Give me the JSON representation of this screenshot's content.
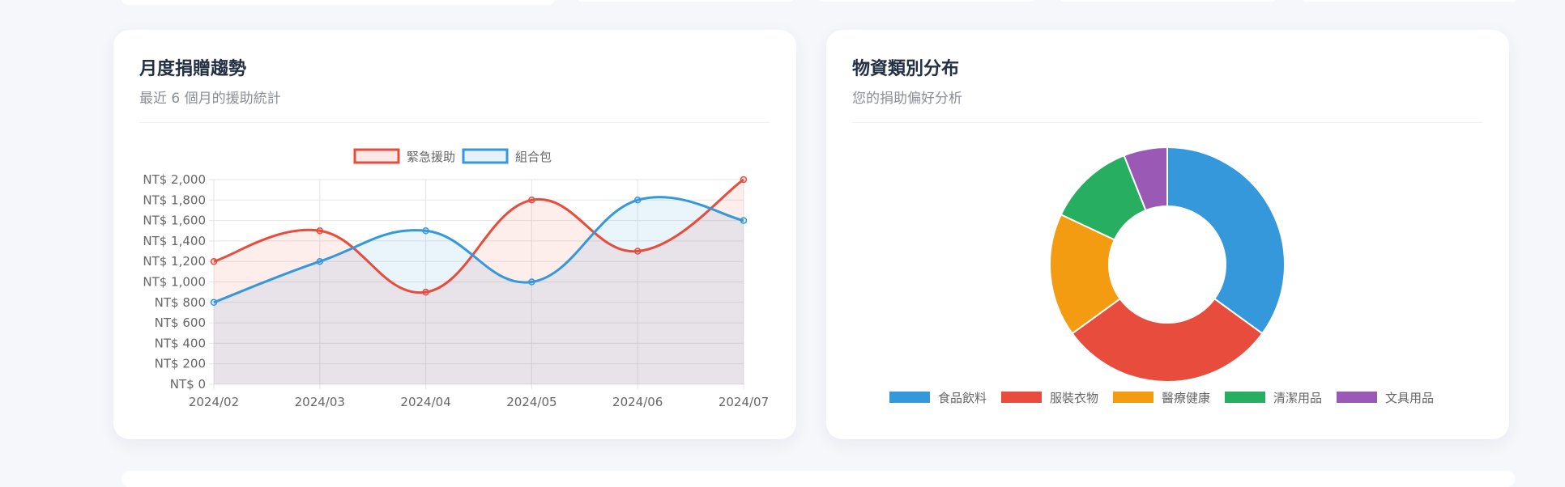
{
  "colors": {
    "emergency": "#e74c3c",
    "package": "#3498db",
    "food": "#3498db",
    "clothing": "#e74c3c",
    "medical": "#f39c12",
    "cleaning": "#27ae60",
    "stationery": "#9b59b6"
  },
  "line_card": {
    "title": "月度捐贈趨勢",
    "subtitle": "最近 6 個月的援助統計"
  },
  "donut_card": {
    "title": "物資類別分布",
    "subtitle": "您的捐助偏好分析"
  },
  "chart_data": [
    {
      "type": "line",
      "categories": [
        "2024/02",
        "2024/03",
        "2024/04",
        "2024/05",
        "2024/06",
        "2024/07"
      ],
      "series": [
        {
          "name": "緊急援助",
          "values": [
            1200,
            1500,
            900,
            1800,
            1300,
            2000
          ]
        },
        {
          "name": "組合包",
          "values": [
            800,
            1200,
            1500,
            1000,
            1800,
            1600
          ]
        }
      ],
      "y_ticks": [
        "NT$ 0",
        "NT$ 200",
        "NT$ 400",
        "NT$ 600",
        "NT$ 800",
        "NT$ 1,000",
        "NT$ 1,200",
        "NT$ 1,400",
        "NT$ 1,600",
        "NT$ 1,800",
        "NT$ 2,000"
      ],
      "ylim": [
        0,
        2000
      ],
      "grid": true,
      "legend": "top-center",
      "area_fill": true
    },
    {
      "type": "pie",
      "donut": true,
      "categories": [
        "食品飲料",
        "服裝衣物",
        "醫療健康",
        "清潔用品",
        "文具用品"
      ],
      "values": [
        35,
        30,
        17,
        12,
        6
      ],
      "legend": "bottom"
    }
  ]
}
